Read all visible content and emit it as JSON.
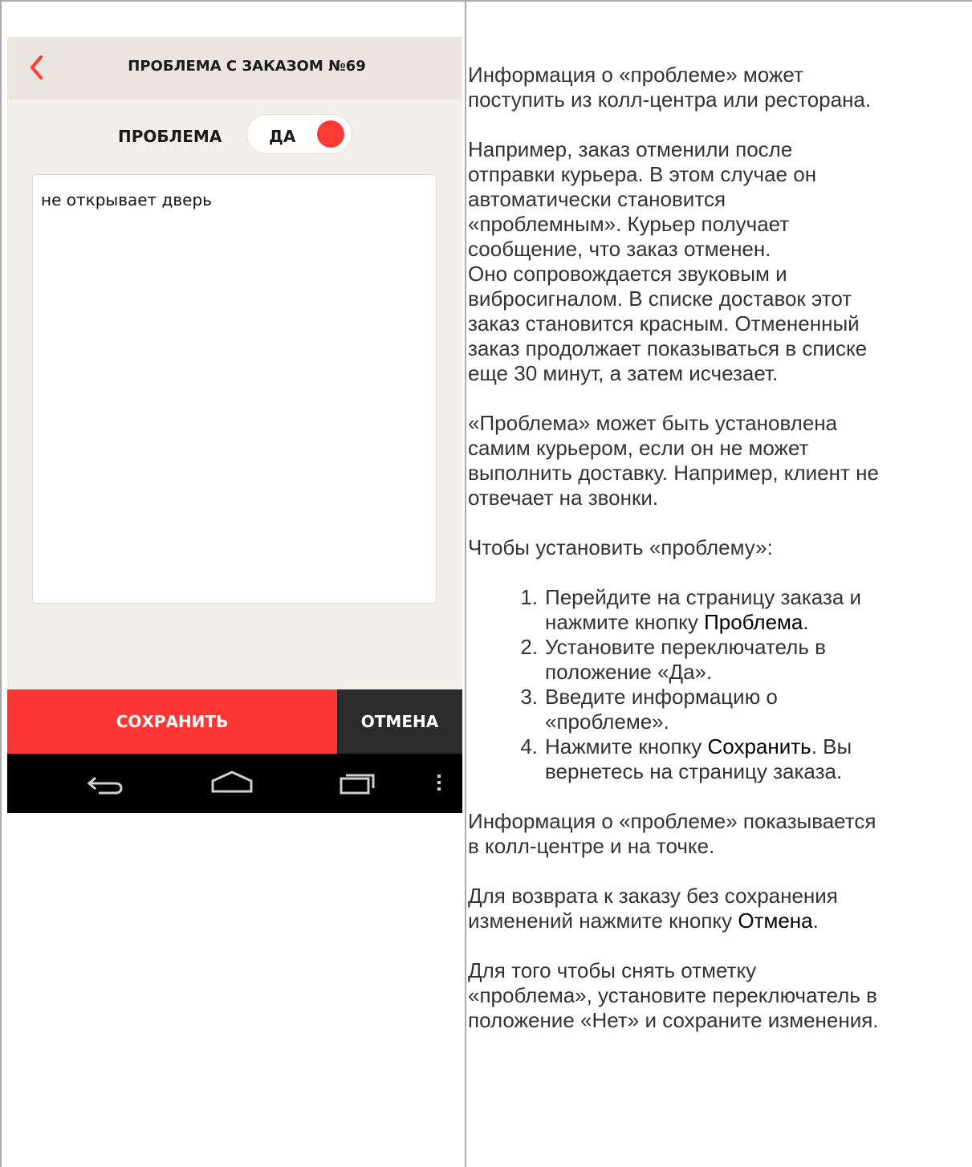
{
  "phone": {
    "title": "ПРОБЛЕМА С ЗАКАЗОМ №69",
    "problem_label": "ПРОБЛЕМА",
    "toggle_value": "ДА",
    "problem_text": "не открывает дверь",
    "save_label": "СОХРАНИТЬ",
    "cancel_label": "ОТМЕНА",
    "colors": {
      "accent": "#ff3636",
      "header_bg": "#ebe5e0",
      "screen_bg": "#f2efeb",
      "cancel_bg": "#2b2b2b"
    }
  },
  "help": {
    "p1": "Информация о «проблеме» может\nпоступить из колл-центра или ресторана.",
    "p2": "Например, заказ отменили после\nотправки курьера. В этом случае он\nавтоматически становится\n«проблемным». Курьер получает\nсообщение, что заказ отменен.\nОно сопровождается звуковым и\nвибросигналом. В списке доставок этот\nзаказ становится красным. Отмененный\nзаказ продолжает показываться в списке\nеще 30 минут, а затем исчезает.",
    "p3": "«Проблема» может быть установлена\nсамим курьером, если он не может\nвыполнить доставку. Например, клиент не\nотвечает на звонки.",
    "p4": "Чтобы установить «проблему»:",
    "steps": [
      {
        "num": "1.",
        "pre": "Перейдите на страницу заказа и\nнажмите кнопку ",
        "bold": "Проблема",
        "post": "."
      },
      {
        "num": "2.",
        "pre": "Установите переключатель в\nположение «Да».",
        "bold": "",
        "post": ""
      },
      {
        "num": "3.",
        "pre": "Введите информацию о\n«проблеме».",
        "bold": "",
        "post": ""
      },
      {
        "num": "4.",
        "pre": "Нажмите кнопку ",
        "bold": "Сохранить",
        "post": ". Вы\nвернетесь на страницу заказа."
      }
    ],
    "p5": "Информация о «проблеме» показывается\nв колл-центре и на точке.",
    "p6": {
      "pre": "Для возврата к заказу без сохранения\nизменений нажмите кнопку ",
      "bold": "Отмена",
      "post": "."
    },
    "p7": "Для того чтобы снять отметку\n«проблема», установите переключатель в\nположение «Нет» и сохраните изменения."
  }
}
